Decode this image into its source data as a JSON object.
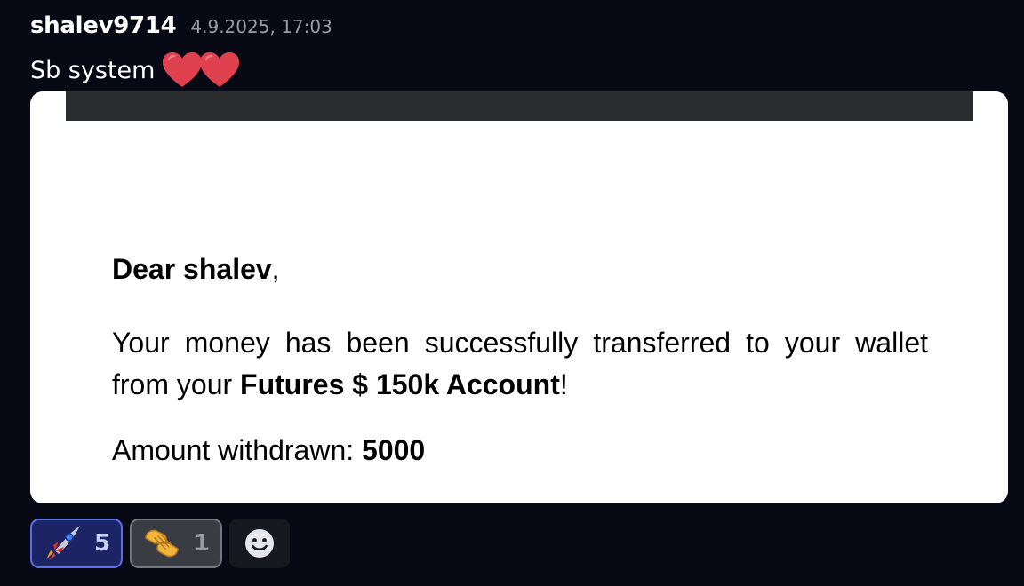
{
  "message": {
    "username": "shalev9714",
    "timestamp": "4.9.2025, 17:03",
    "text": "Sb system",
    "text_emojis": [
      "red-heart",
      "red-heart"
    ]
  },
  "attachment": {
    "greeting_name": "Dear shalev",
    "greeting_punct": ",",
    "body_pre": "Your money has been successfully transferred to your wallet from your ",
    "body_bold": "Futures $ 150k Account",
    "body_post": "!",
    "amount_label": "Amount withdrawn: ",
    "amount_value": "5000"
  },
  "reactions": [
    {
      "emoji": "rocket",
      "count": "5",
      "selected": true
    },
    {
      "emoji": "handshake-fist",
      "count": "1",
      "selected": false
    }
  ],
  "add_reaction_icon": "smiley-face-icon",
  "colors": {
    "background": "#070a14",
    "heart": "#e0414f",
    "reaction_selected_bg": "#1d2466",
    "reaction_selected_border": "#5e6ce8",
    "reaction_bg": "#3a3c43"
  }
}
